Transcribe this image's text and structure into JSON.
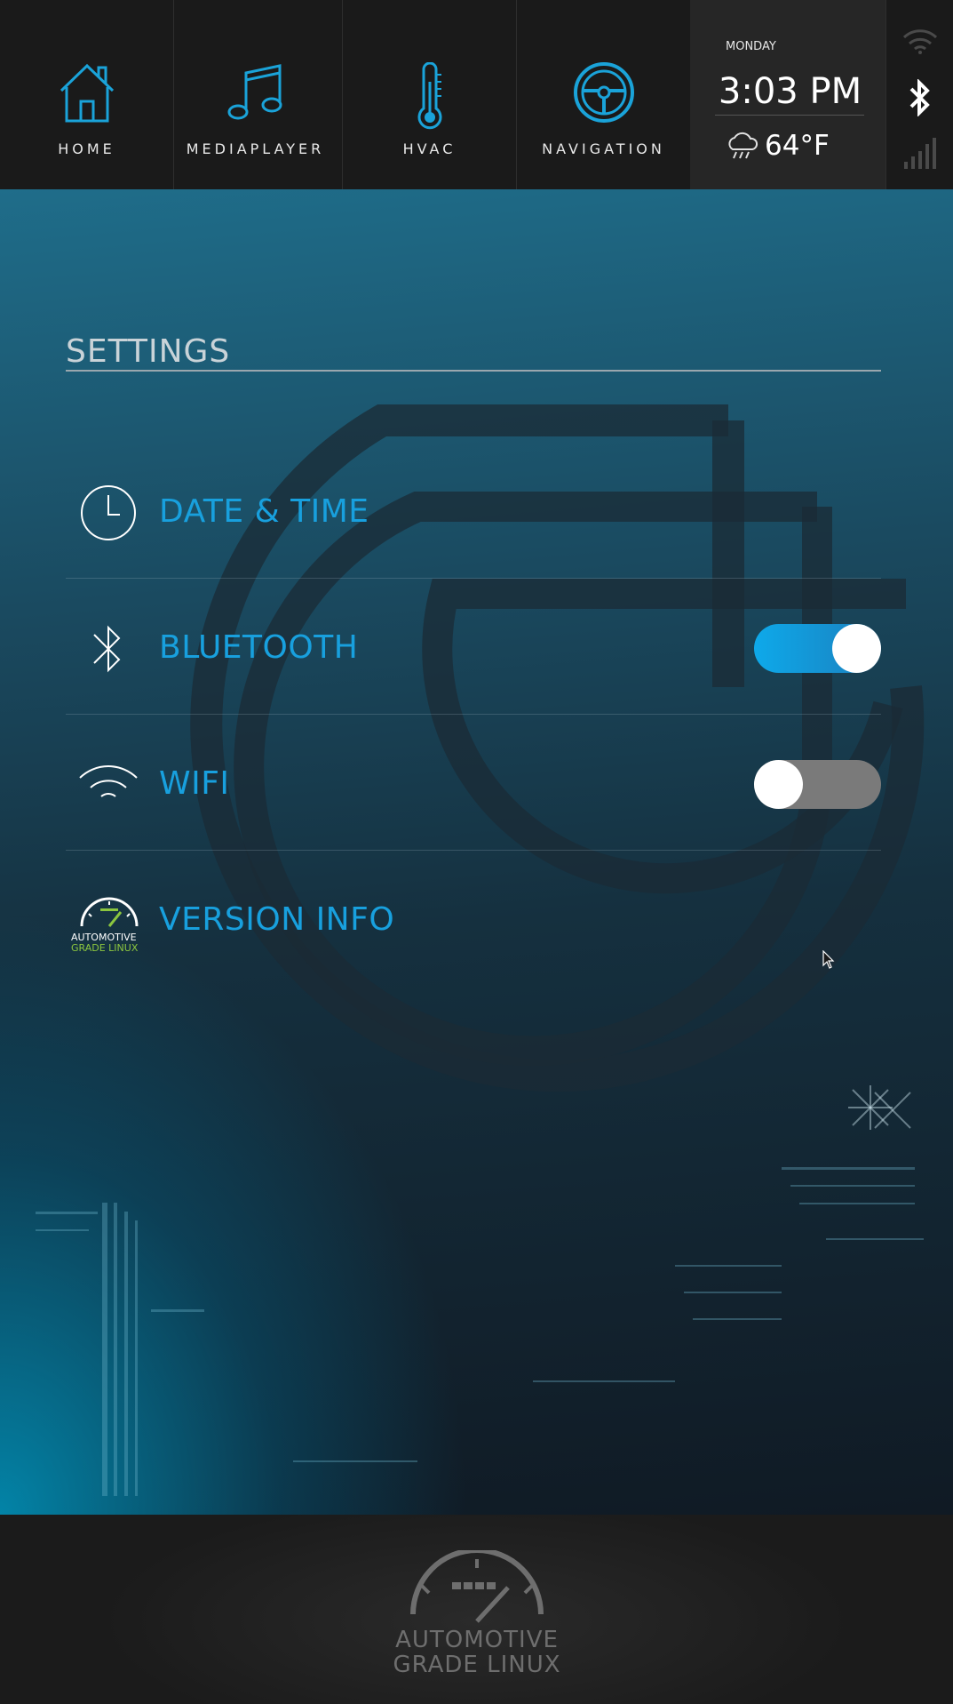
{
  "topbar": {
    "nav": [
      {
        "label": "HOME",
        "icon": "home-icon"
      },
      {
        "label": "MEDIAPLAYER",
        "icon": "music-note-icon"
      },
      {
        "label": "HVAC",
        "icon": "thermometer-icon"
      },
      {
        "label": "NAVIGATION",
        "icon": "steering-wheel-icon"
      }
    ],
    "clock": {
      "day": "MONDAY",
      "time": "3:03 PM",
      "temperature": "64°F",
      "weather_icon": "rain-cloud-icon"
    },
    "status_icons": [
      "wifi-icon",
      "bluetooth-icon",
      "signal-strength-icon"
    ]
  },
  "settings": {
    "title": "SETTINGS",
    "items": [
      {
        "label": "DATE & TIME",
        "icon": "clock-icon"
      },
      {
        "label": "BLUETOOTH",
        "icon": "bluetooth-icon",
        "toggle": true
      },
      {
        "label": "WIFI",
        "icon": "wifi-icon",
        "toggle": false
      },
      {
        "label": "VERSION INFO",
        "icon": "agl-logo-icon",
        "icon_text_1": "AUTOMOTIVE",
        "icon_text_2": "GRADE LINUX"
      }
    ]
  },
  "footer": {
    "logo_line1": "AUTOMOTIVE",
    "logo_line2": "GRADE LINUX"
  },
  "colors": {
    "accent": "#18a0de",
    "toggle_on": "#0ea9ea",
    "toggle_off": "#7a7a7a",
    "topbar_bg": "#1a1a1a",
    "icon_accent": "#1aa3d9",
    "agl_green": "#8cc63f"
  }
}
